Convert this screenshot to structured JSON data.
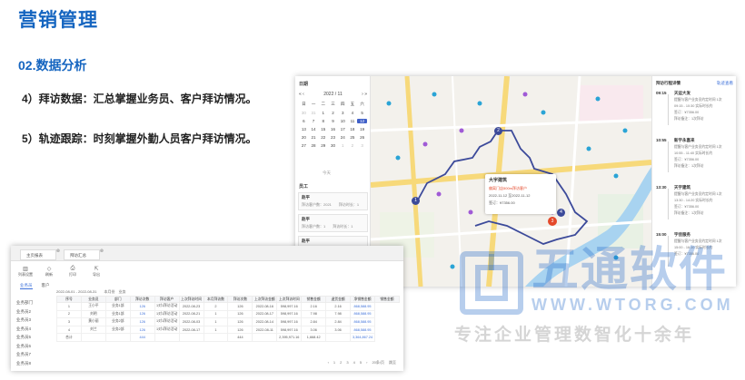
{
  "slide": {
    "title": "营销管理",
    "section": "02.数据分析",
    "items": [
      "4）拜访数据：汇总掌握业务员、客户拜访情况。",
      "5）轨迹跟踪：时刻掌握外勤人员客户拜访情况。"
    ]
  },
  "map_shot": {
    "calendar": {
      "label": "日期",
      "prev": "«  ‹",
      "month": "2022 / 11",
      "next": "›  »",
      "weekdays": [
        "日",
        "一",
        "二",
        "三",
        "四",
        "五",
        "六"
      ],
      "days": [
        "30",
        "31",
        "1",
        "2",
        "3",
        "4",
        "5",
        "6",
        "7",
        "8",
        "9",
        "10",
        "11",
        "12",
        "13",
        "14",
        "15",
        "16",
        "17",
        "18",
        "19",
        "20",
        "21",
        "22",
        "23",
        "24",
        "25",
        "26",
        "27",
        "28",
        "29",
        "30",
        "1",
        "2",
        "3"
      ],
      "selected_day": "12",
      "footer": "今天"
    },
    "staff": {
      "label": "员工",
      "cards": [
        {
          "name": "赵平",
          "stats": "拜访客户数：2021　　拜访时长：1"
        },
        {
          "name": "赵平",
          "stats": "拜访客户数：1　　拜访时长：1"
        },
        {
          "name": "赵平",
          "stats": "拜访客户数：1"
        }
      ]
    },
    "markers": [
      "1",
      "2",
      "3",
      "4"
    ],
    "popup": {
      "title": "大宇建筑",
      "lines": [
        "偏离门店500m拜访客户",
        "2022-11-12 至2022-11-12",
        "签订：¥7356.00"
      ]
    },
    "trace": {
      "title": "拜访行程详情",
      "link": "轨迹查看",
      "items": [
        {
          "time": "09:15",
          "customer": "天运大发",
          "lines": [
            "提醒与客户业务员约定时间 1次",
            "09:15 - 10:30 实际时长约",
            "签订：¥7356.00",
            "拜访备注：1次拜访"
          ]
        },
        {
          "time": "10:55",
          "customer": "新宇永喜来",
          "lines": [
            "提醒与客户业务员约定时间 1次",
            "10:55 - 11:40 实际时长约",
            "签订：¥7356.00",
            "拜访备注：1次拜访"
          ]
        },
        {
          "time": "13:30",
          "customer": "天宇建筑",
          "lines": [
            "提醒与客户业务员约定时间 1次",
            "13:30 - 14:20 实际时长约",
            "签订：¥7356.00",
            "拜访备注：1次拜访"
          ]
        },
        {
          "time": "15:00",
          "customer": "宇佳服务",
          "lines": [
            "提醒与客户业务员约定时间 1次",
            "15:00 - 16:10 实际时长约",
            "签订：¥7356.00"
          ]
        }
      ]
    }
  },
  "table_shot": {
    "tabs": [
      {
        "label": "主页报表"
      },
      {
        "label": "拜访汇总"
      }
    ],
    "toolbar": [
      {
        "icon": "▥",
        "label": "列表设置"
      },
      {
        "icon": "◇",
        "label": "刷新"
      },
      {
        "icon": "⎙",
        "label": "打印"
      },
      {
        "icon": "⇱",
        "label": "导出"
      }
    ],
    "subtabs": [
      "业务员",
      "客户"
    ],
    "filter": "2022-08-01 - 2022-08-31　　本月份　业务",
    "sidebar": [
      "业务部门",
      "业务员2",
      "业务员3",
      "业务员4",
      "业务员5",
      "业务员6",
      "业务员7",
      "业务员8"
    ],
    "columns": [
      "序号",
      "业务员",
      "部门",
      "拜访次数",
      "拜访客户",
      "上次拜访时间",
      "本月拜访数",
      "拜访次数",
      "上次拜访金额",
      "上次拜访时间",
      "销售金额",
      "退货金额",
      "净销售金额",
      "销售金额"
    ],
    "rows": [
      [
        "1",
        "王小平",
        "业务1部",
        "126",
        "1对1拜访活动",
        "2022-08-23",
        "2",
        "126",
        "2022-08-16",
        "598,997.16",
        "2.16",
        "2.16",
        "868,588.95"
      ],
      [
        "2",
        "刘明",
        "业务1部",
        "126",
        "1对1拜访活动",
        "2022-08-21",
        "1",
        "126",
        "2022-08-17",
        "598,997.16",
        "7.98",
        "7.98",
        "868,588.95"
      ],
      [
        "3",
        "黄小丽",
        "业务2部",
        "126",
        "1对1拜访活动",
        "2022-08-03",
        "1",
        "126",
        "2022-08-14",
        "598,997.16",
        "2.84",
        "2.84",
        "868,588.95"
      ],
      [
        "4",
        "刘兰",
        "业务2部",
        "126",
        "1对1拜访活动",
        "2022-08-17",
        "1",
        "126",
        "2022-08-11",
        "598,997.16",
        "3.06",
        "3.06",
        "868,588.95"
      ],
      [
        "合计",
        "",
        "",
        "444",
        "",
        "",
        "",
        "444",
        "",
        "2,395,971.16",
        "1,668.42",
        "",
        "3,364,867.24"
      ]
    ],
    "pager": [
      "‹",
      "1",
      "2",
      "3",
      "4",
      "5",
      "›",
      "20条/页",
      "跳至"
    ]
  },
  "watermark": {
    "title": "五通软件",
    "url": "WWW.WTORG.COM",
    "slogan": "专注企业管理数智化十余年"
  },
  "colors": {
    "accent": "#1565c0",
    "link": "#3b6fd9",
    "route": "#3c4a9a"
  }
}
